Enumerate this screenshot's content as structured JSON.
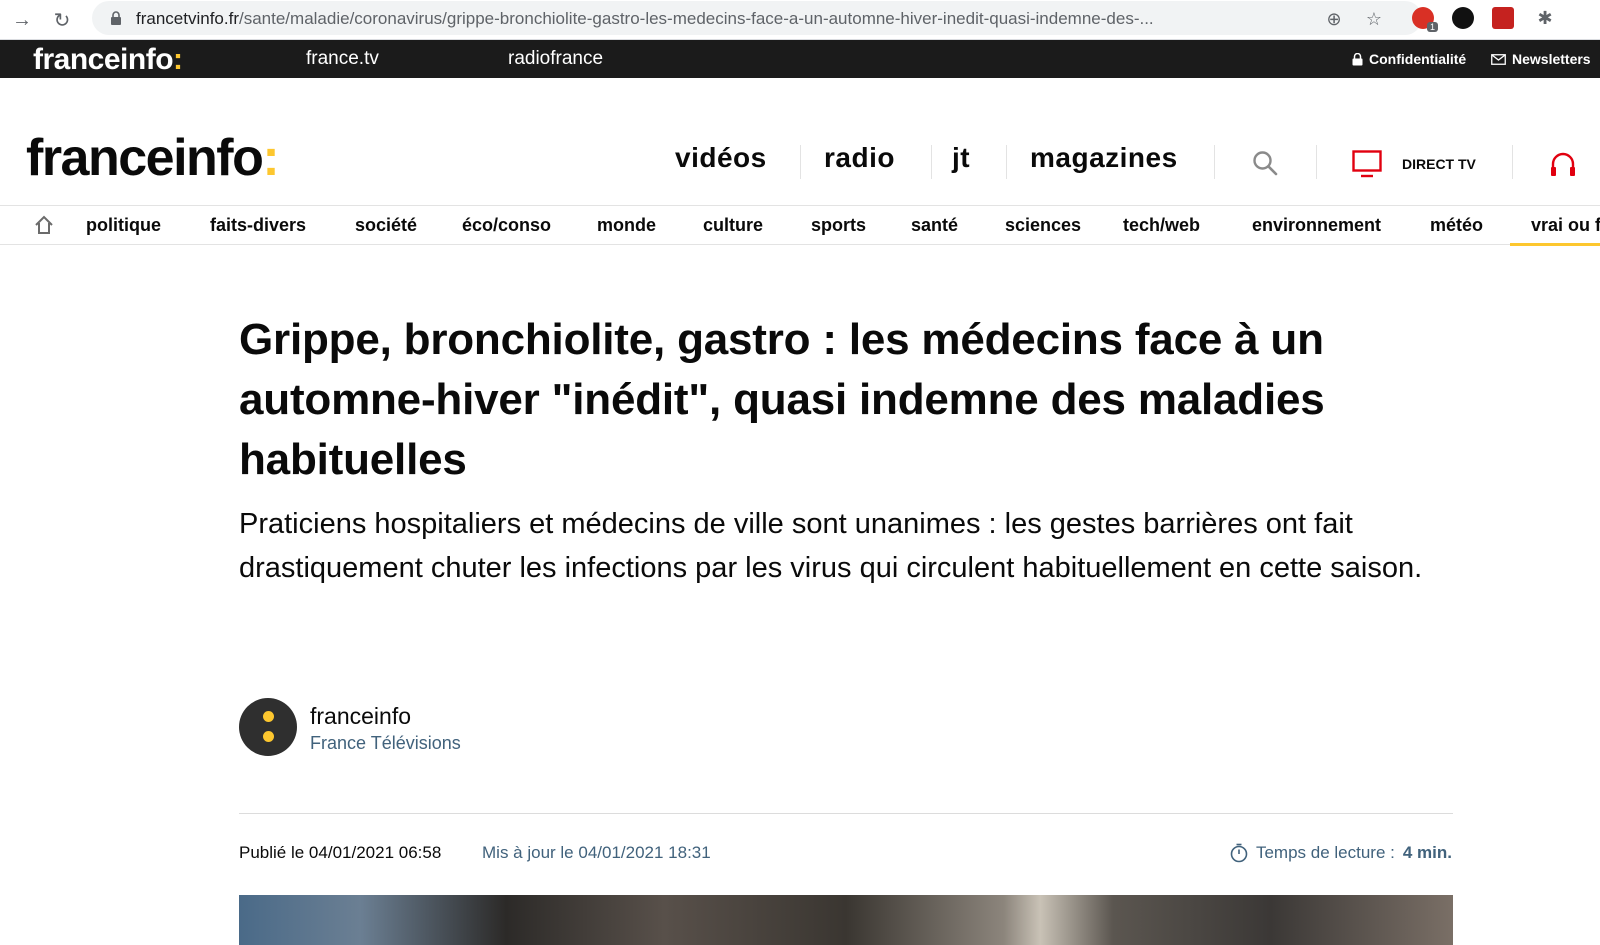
{
  "browser": {
    "url_domain": "francetvinfo.fr",
    "url_path": "/sante/maladie/coronavirus/grippe-bronchiolite-gastro-les-medecins-face-a-un-automne-hiver-inedit-quasi-indemne-des-...",
    "ext_badge": "1"
  },
  "topbar": {
    "logo": "franceinfo",
    "logo_colon": ":",
    "link_francetv": "france.tv",
    "link_radiofrance": "radiofrance",
    "privacy": "Confidentialité",
    "newsletters": "Newsletters"
  },
  "header": {
    "logo": "franceinfo",
    "logo_colon": ":",
    "nav": [
      "vidéos",
      "radio",
      "jt",
      "magazines"
    ],
    "direct_tv": "DIRECT TV"
  },
  "categories": [
    "politique",
    "faits-divers",
    "société",
    "éco/conso",
    "monde",
    "culture",
    "sports",
    "santé",
    "sciences",
    "tech/web",
    "environnement",
    "météo",
    "vrai ou f"
  ],
  "article": {
    "headline": "Grippe, bronchiolite, gastro : les médecins face à un automne-hiver \"inédit\", quasi indemne des maladies habituelles",
    "chapo": "Praticiens hospitaliers et médecins de ville sont unanimes : les gestes barrières ont fait drastiquement chuter les infections par les virus qui circulent habituellement en cette saison.",
    "author_name": "franceinfo",
    "author_org": "France Télévisions",
    "published": "Publié le 04/01/2021 06:58",
    "updated": "Mis à jour le 04/01/2021 18:31",
    "reading_label": "Temps de lecture :",
    "reading_value": "4 min."
  },
  "colors": {
    "accent_yellow": "#fdc72f",
    "topbar_bg": "#1b1b1b",
    "meta_blue": "#41627c",
    "direct_red": "#e1000f"
  }
}
